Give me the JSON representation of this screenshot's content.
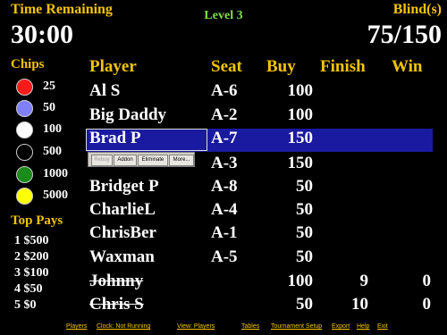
{
  "header": {
    "time_label": "Time Remaining",
    "time_value": "30:00",
    "level": "Level 3",
    "blinds_label": "Blind(s)",
    "blinds_value": "75/150"
  },
  "chips": {
    "title": "Chips",
    "items": [
      {
        "value": "25",
        "color": "#ff1a1a"
      },
      {
        "value": "50",
        "color": "#8080ff"
      },
      {
        "value": "100",
        "color": "#ffffff"
      },
      {
        "value": "500",
        "color": "#000000"
      },
      {
        "value": "1000",
        "color": "#1a8a1a"
      },
      {
        "value": "5000",
        "color": "#ffff00"
      }
    ]
  },
  "top_pays": {
    "title": "Top Pays",
    "items": [
      "1 $500",
      "2 $200",
      "3 $100",
      "4 $50",
      "5 $0"
    ]
  },
  "table": {
    "headers": {
      "player": "Player",
      "seat": "Seat",
      "buy": "Buy",
      "finish": "Finish",
      "win": "Win"
    },
    "rows": [
      {
        "player": "Al S",
        "seat": "A-6",
        "buy": "100",
        "finish": "",
        "win": ""
      },
      {
        "player": "Big Daddy",
        "seat": "A-2",
        "buy": "100",
        "finish": "",
        "win": ""
      },
      {
        "player": "Brad P",
        "seat": "A-7",
        "buy": "150",
        "finish": "",
        "win": ""
      },
      {
        "player": "",
        "seat": "A-3",
        "buy": "150",
        "finish": "",
        "win": ""
      },
      {
        "player": "Bridget P",
        "seat": "A-8",
        "buy": "50",
        "finish": "",
        "win": ""
      },
      {
        "player": "CharlieL",
        "seat": "A-4",
        "buy": "50",
        "finish": "",
        "win": ""
      },
      {
        "player": "ChrisBer",
        "seat": "A-1",
        "buy": "50",
        "finish": "",
        "win": ""
      },
      {
        "player": "Waxman",
        "seat": "A-5",
        "buy": "50",
        "finish": "",
        "win": ""
      },
      {
        "player": "Johnny",
        "seat": "",
        "buy": "100",
        "finish": "9",
        "win": "0"
      },
      {
        "player": "Chris S",
        "seat": "",
        "buy": "50",
        "finish": "10",
        "win": "0"
      }
    ]
  },
  "popup": {
    "buttons": [
      "Rebuy",
      "Addon",
      "Eliminate",
      "More..."
    ]
  },
  "bottom_links": [
    "Players",
    "Clock: Not Running",
    "View: Players",
    "Tables",
    "Tournament Setup",
    "Export",
    "Help",
    "Exit"
  ]
}
